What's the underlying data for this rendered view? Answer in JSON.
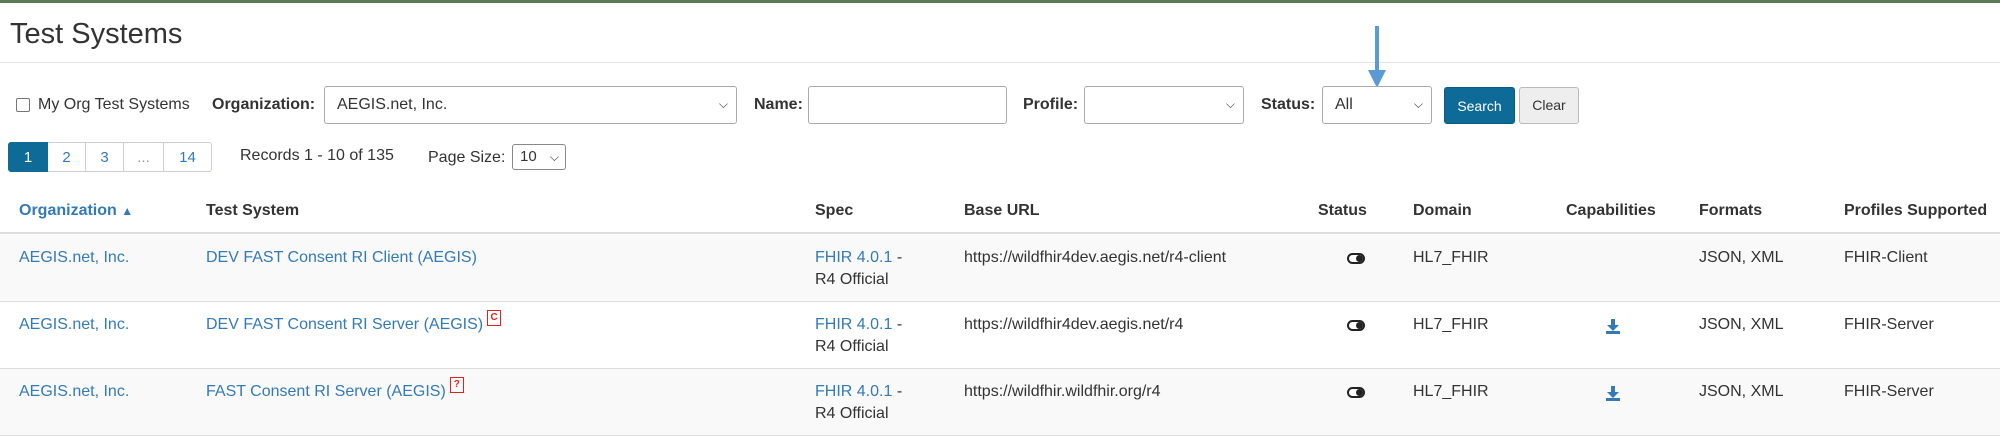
{
  "page": {
    "title": "Test Systems"
  },
  "filters": {
    "my_org_label": "My Org Test Systems",
    "organization_label": "Organization:",
    "organization_value": "AEGIS.net, Inc.",
    "name_label": "Name:",
    "name_value": "",
    "profile_label": "Profile:",
    "profile_value": "",
    "status_label": "Status:",
    "status_value": "All",
    "search_label": "Search",
    "clear_label": "Clear"
  },
  "pagination": {
    "pages": [
      "1",
      "2",
      "3",
      "...",
      "14"
    ],
    "active_page": "1",
    "records_text": "Records 1 - 10 of 135",
    "page_size_label": "Page Size:",
    "page_size_value": "10"
  },
  "table": {
    "headers": {
      "organization": "Organization",
      "test_system": "Test System",
      "spec": "Spec",
      "base_url": "Base URL",
      "status": "Status",
      "domain": "Domain",
      "capabilities": "Capabilities",
      "formats": "Formats",
      "profiles": "Profiles Supported"
    },
    "rows": [
      {
        "organization": "AEGIS.net, Inc.",
        "test_system": "DEV FAST Consent RI Client (AEGIS)",
        "badge": "",
        "spec_link": "FHIR 4.0.1",
        "spec_sep": "-",
        "spec_sub": "R4 Official",
        "base_url": "https://wildfhir4dev.aegis.net/r4-client",
        "status": "on",
        "domain": "HL7_FHIR",
        "capabilities": false,
        "formats": "JSON, XML",
        "profiles": "FHIR-Client"
      },
      {
        "organization": "AEGIS.net, Inc.",
        "test_system": "DEV FAST Consent RI Server (AEGIS)",
        "badge": "C",
        "spec_link": "FHIR 4.0.1",
        "spec_sep": "-",
        "spec_sub": "R4 Official",
        "base_url": "https://wildfhir4dev.aegis.net/r4",
        "status": "on",
        "domain": "HL7_FHIR",
        "capabilities": true,
        "formats": "JSON, XML",
        "profiles": "FHIR-Server"
      },
      {
        "organization": "AEGIS.net, Inc.",
        "test_system": "FAST Consent RI Server (AEGIS)",
        "badge": "?",
        "spec_link": "FHIR 4.0.1",
        "spec_sep": "-",
        "spec_sub": "R4 Official",
        "base_url": "https://wildfhir.wildfhir.org/r4",
        "status": "on",
        "domain": "HL7_FHIR",
        "capabilities": true,
        "formats": "JSON, XML",
        "profiles": "FHIR-Server"
      }
    ]
  },
  "icons": {
    "annotation_arrow_color": "#5b9bd5",
    "link_color": "#337ab7",
    "primary_button_color": "#0e6a96"
  }
}
